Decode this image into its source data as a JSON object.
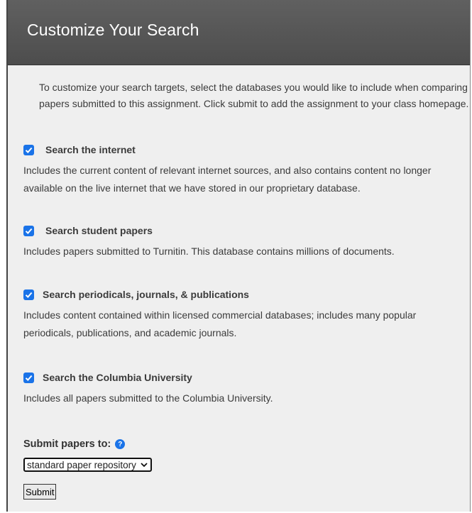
{
  "header": {
    "title": "Customize Your Search"
  },
  "intro": "To customize your search targets, select the databases you would like to include when comparing papers submitted to this assignment. Click submit to add the assignment to your class homepage.",
  "options": [
    {
      "checked": true,
      "title": "Search the internet",
      "description": "Includes the current content of relevant internet sources, and also contains content no longer available on the live internet that we have stored in our proprietary database."
    },
    {
      "checked": true,
      "title": "Search student papers",
      "description": "Includes papers submitted to Turnitin. This database contains millions of documents."
    },
    {
      "checked": true,
      "title": "Search periodicals, journals, & publications",
      "description": "Includes content contained within licensed commercial databases; includes many popular periodicals, publications, and academic journals."
    },
    {
      "checked": true,
      "title": "Search the Columbia University",
      "description": "Includes all papers submitted to the Columbia University."
    }
  ],
  "submit_to": {
    "label": "Submit papers to:",
    "help_icon": "?",
    "selected": "standard paper repository"
  },
  "submit_button": "Submit",
  "colors": {
    "header_bg": "#555555",
    "panel_bg": "#efefef",
    "accent": "#1a73e8"
  }
}
